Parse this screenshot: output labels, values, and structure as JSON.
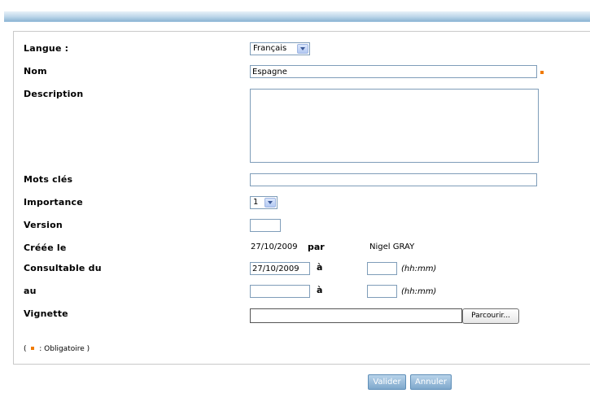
{
  "form": {
    "langue_label": "Langue :",
    "langue_value": "Français",
    "nom_label": "Nom",
    "nom_value": "Espagne",
    "description_label": "Description",
    "description_value": "",
    "mots_cles_label": "Mots clés",
    "mots_cles_value": "",
    "importance_label": "Importance",
    "importance_value": "1",
    "version_label": "Version",
    "version_value": "",
    "creee_le_label": "Créée le",
    "creee_le_value": "27/10/2009",
    "par_label": "par",
    "creator": "Nigel GRAY",
    "consultable_du_label": "Consultable du",
    "consultable_du_value": "27/10/2009",
    "a_label": "à",
    "time_hint": "(hh:mm)",
    "au_label": "au",
    "au_value": "",
    "vignette_label": "Vignette",
    "browse_label": "Parcourir...",
    "legend_open": "(",
    "legend_text": ": Obligatoire )"
  },
  "actions": {
    "valider": "Valider",
    "annuler": "Annuler"
  },
  "colors": {
    "required_marker": "#f07a00",
    "button_bg": "#8fb6d8"
  }
}
